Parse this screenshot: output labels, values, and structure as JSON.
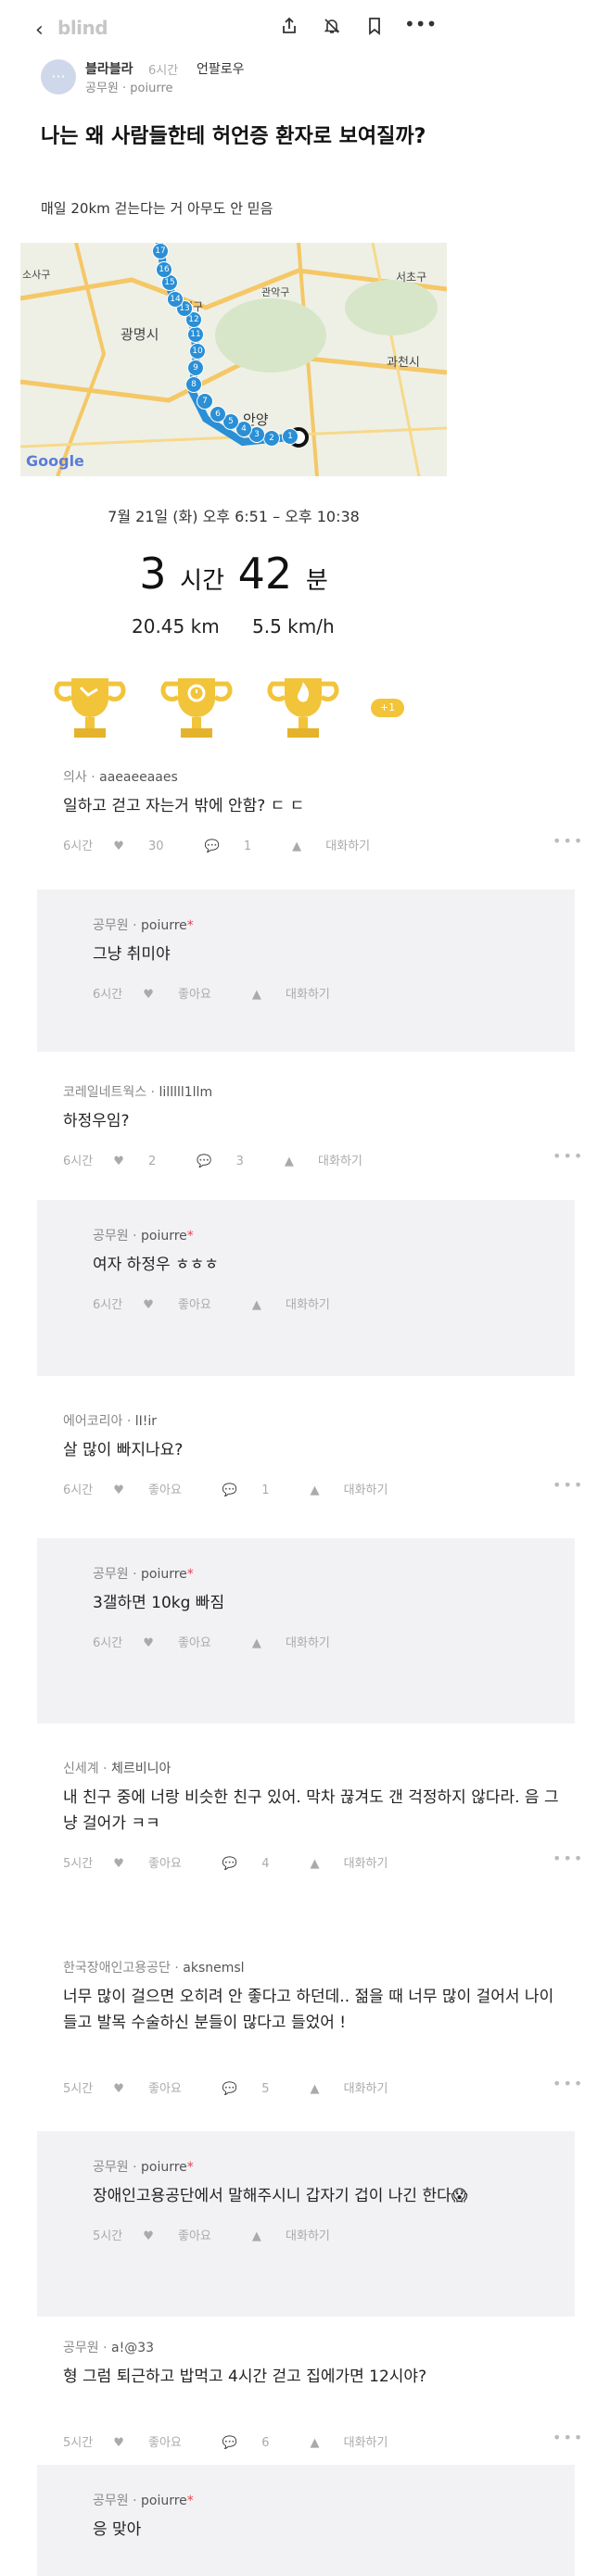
{
  "topbar": {
    "back_icon": "chevron-left-icon",
    "logo": "blind",
    "icons": [
      "share-icon",
      "bell-off-icon",
      "bookmark-icon",
      "more-icon"
    ]
  },
  "channel": {
    "avatar_glyph": "···",
    "name": "블라블라",
    "time": "6시간",
    "follow": "언팔로우",
    "author": "공무원 · poiurre"
  },
  "post": {
    "title": "나는 왜 사람들한테 허언증 환자로 보여질까?",
    "body": "매일 20km 걷는다는 거 아무도 안 믿음"
  },
  "map": {
    "labels": [
      "소사구",
      "천구",
      "관악구",
      "서초구",
      "광명시",
      "과천시",
      "Google",
      "안양"
    ],
    "markers": [
      "1",
      "2",
      "3",
      "4",
      "5",
      "6",
      "7",
      "8",
      "9",
      "10",
      "11",
      "12",
      "13",
      "14",
      "15",
      "16",
      "17"
    ]
  },
  "workout": {
    "date": "7월 21일 (화) 오후 6:51 – 오후 10:38",
    "hours": "3",
    "hours_unit": "시간",
    "minutes": "42",
    "minutes_unit": "분",
    "distance": "20.45 km",
    "speed": "5.5 km/h",
    "badge": "+1"
  },
  "comments": [
    {
      "company": "의사",
      "user": "aaeaeeaaes",
      "text": "일하고 걷고 자는거 밖에 안함? ㄷ ㄷ",
      "time": "6시간",
      "likes": "30",
      "replies": "1",
      "reply_btn": "대화하기"
    },
    {
      "reply": true,
      "company": "공무원",
      "user": "poiurre",
      "text": "그냥 취미야",
      "time": "6시간",
      "likes": "좋아요",
      "reply_btn": "대화하기"
    },
    {
      "company": "코레일네트웍스",
      "user": "lilllll1llm",
      "text": "하정우임?",
      "time": "6시간",
      "likes": "2",
      "replies": "3",
      "reply_btn": "대화하기"
    },
    {
      "reply": true,
      "company": "공무원",
      "user": "poiurre",
      "text": "여자 하정우 ㅎㅎㅎ",
      "time": "6시간",
      "likes": "좋아요",
      "reply_btn": "대화하기"
    },
    {
      "company": "에어코리아",
      "user": "lI!ir",
      "text": "살 많이 빠지나요?",
      "time": "6시간",
      "likes": "좋아요",
      "replies": "1",
      "reply_btn": "대화하기"
    },
    {
      "reply": true,
      "company": "공무원",
      "user": "poiurre",
      "text": "3갤하면 10kg 빠짐",
      "time": "6시간",
      "likes": "좋아요",
      "reply_btn": "대화하기"
    },
    {
      "company": "신세계",
      "user": "체르비니아",
      "text": "내 친구 중에 너랑 비슷한 친구 있어. 막차 끊겨도 갠 걱정하지 않다라. 음 그냥 걸어가 ㅋㅋ",
      "time": "5시간",
      "likes": "좋아요",
      "replies": "4",
      "reply_btn": "대화하기"
    },
    {
      "company": "한국장애인고용공단",
      "user": "aksnemsl",
      "text": "너무 많이 걸으면 오히려 안 좋다고 하던데.. 젊을 때 너무 많이 걸어서 나이들고 발목 수술하신 분들이 많다고 들었어 !",
      "time": "5시간",
      "likes": "좋아요",
      "replies": "5",
      "reply_btn": "대화하기"
    },
    {
      "reply": true,
      "company": "공무원",
      "user": "poiurre",
      "text": "장애인고용공단에서 말해주시니 갑자기 겁이 나긴 한다😱",
      "time": "5시간",
      "likes": "좋아요",
      "reply_btn": "대화하기"
    },
    {
      "company": "공무원",
      "user": "a!@33",
      "text": "형 그럼 퇴근하고 밥먹고 4시간 걷고 집에가면 12시야?",
      "time": "5시간",
      "likes": "좋아요",
      "replies": "6",
      "reply_btn": "대화하기"
    },
    {
      "reply": true,
      "company": "공무원",
      "user": "poiurre",
      "text": "응 맞아",
      "time": "",
      "likes": "",
      "reply_btn": ""
    }
  ],
  "colors": {
    "accent_star": "#e8434a",
    "reply_bg": "#f2f2f4",
    "trophy": "#f2c43a",
    "route": "#2a8fd6"
  }
}
